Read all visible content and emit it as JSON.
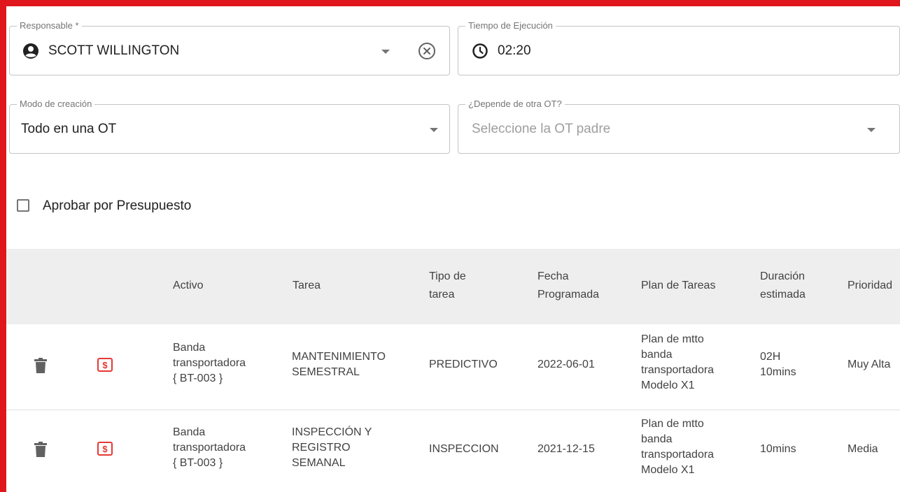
{
  "form": {
    "responsable": {
      "label": "Responsable *",
      "value": "SCOTT WILLINGTON"
    },
    "tiempo": {
      "label": "Tiempo de Ejecución",
      "value": "02:20"
    },
    "modo": {
      "label": "Modo de creación",
      "value": "Todo en una OT"
    },
    "depende": {
      "label": "¿Depende de otra OT?",
      "placeholder": "Seleccione la OT padre"
    },
    "aprobar": {
      "label": "Aprobar por Presupuesto",
      "checked": false
    }
  },
  "icons": {
    "responsable": "account-circle-icon",
    "clear": "clear-circle-icon",
    "clock": "clock-icon",
    "dropdown": "arrow-drop-down-icon",
    "delete": "trash-icon",
    "budget": "dollar-badge-icon"
  },
  "colors": {
    "accent_border": "#e0161d",
    "budget_icon": "#e53935"
  },
  "table": {
    "headers": [
      "Activo",
      "Tarea",
      "Tipo de\ntarea",
      "Fecha\nProgramada",
      "Plan de Tareas",
      "Duración\nestimada",
      "Prioridad"
    ],
    "rows": [
      {
        "activo": "Banda\ntransportadora\n{ BT-003 }",
        "tarea": "MANTENIMIENTO\nSEMESTRAL",
        "tipo": "PREDICTIVO",
        "fecha": "2022-06-01",
        "plan": "Plan de mtto\nbanda\ntransportadora\nModelo X1",
        "duracion": "02H\n10mins",
        "prioridad": "Muy Alta"
      },
      {
        "activo": "Banda\ntransportadora\n{ BT-003 }",
        "tarea": "INSPECCIÓN Y\nREGISTRO\nSEMANAL",
        "tipo": "INSPECCION",
        "fecha": "2021-12-15",
        "plan": "Plan de mtto\nbanda\ntransportadora\nModelo X1",
        "duracion": "10mins",
        "prioridad": "Media"
      }
    ]
  }
}
